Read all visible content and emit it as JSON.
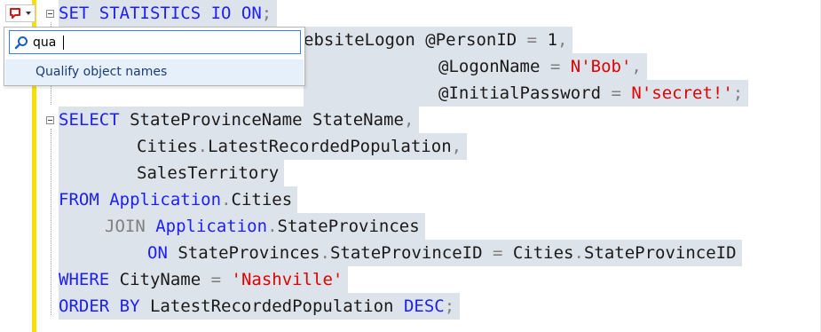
{
  "search": {
    "value": "qua"
  },
  "results": [
    {
      "label": "Qualify object names"
    }
  ],
  "code": {
    "l1": [
      "SET STATISTICS IO ON",
      ";"
    ],
    "l2": [
      "ebsiteLogon ",
      "@PersonID ",
      "=",
      " 1",
      ","
    ],
    "l3": [
      "@LogonName ",
      "=",
      " ",
      "N'Bob'",
      ","
    ],
    "l4": [
      "@InitialPassword ",
      "=",
      " ",
      "N'secret!'",
      ";"
    ],
    "l5": [
      "SELECT",
      " StateProvinceName StateName",
      ","
    ],
    "l6": [
      "Cities",
      ".",
      "LatestRecordedPopulation",
      ","
    ],
    "l7": [
      "SalesTerritory"
    ],
    "l8": [
      "FROM",
      " ",
      "Application",
      ".",
      "Cities"
    ],
    "l9": [
      "JOIN",
      " ",
      "Application",
      ".",
      "StateProvinces"
    ],
    "l10": [
      "ON",
      " StateProvinces",
      ".",
      "StateProvinceID ",
      "=",
      " Cities",
      ".",
      "StateProvinceID"
    ],
    "l11": [
      "WHERE",
      " CityName ",
      "=",
      " ",
      "'Nashville'"
    ],
    "l12": [
      "ORDER BY",
      " LatestRecordedPopulation ",
      "DESC",
      ";"
    ]
  },
  "colors": {
    "keyword": "#1e1efa",
    "string": "#e00000",
    "operator": "#808080",
    "selection": "#dde3ea",
    "gutter_change": "#f5e000"
  }
}
